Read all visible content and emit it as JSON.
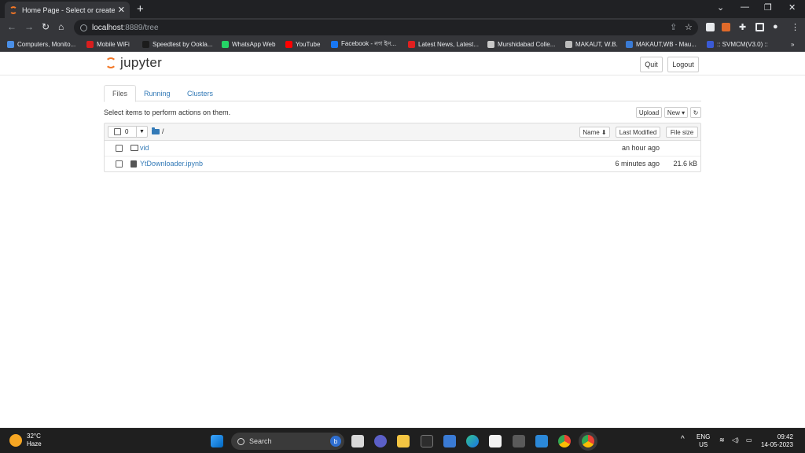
{
  "browser": {
    "tab_title": "Home Page - Select or create a n",
    "tab_close": "✕",
    "new_tab": "+",
    "url_host": "localhost",
    "url_path": ":8889/tree",
    "bookmarks": [
      {
        "label": "Computers, Monito...",
        "color": "#4a8fe7"
      },
      {
        "label": "Mobile WiFi",
        "color": "#d81e1e"
      },
      {
        "label": "Speedtest by Ookla...",
        "color": "#1c1c1c"
      },
      {
        "label": "WhatsApp Web",
        "color": "#25d366"
      },
      {
        "label": "YouTube",
        "color": "#ff0000"
      },
      {
        "label": "Facebook - নগ ইন...",
        "color": "#1877f2"
      },
      {
        "label": "Latest News, Latest...",
        "color": "#e02020"
      },
      {
        "label": "Murshidabad Colle...",
        "color": "#c9c9c9"
      },
      {
        "label": "MAKAUT, W.B.",
        "color": "#bbbbbb"
      },
      {
        "label": "MAKAUT,WB - Mau...",
        "color": "#3a7bd5"
      },
      {
        "label": ":: SVMCM(V3.0) ::",
        "color": "#3a5ad5"
      }
    ],
    "more_bookmarks": "»"
  },
  "jupyter": {
    "logo_text": "jupyter",
    "quit_label": "Quit",
    "logout_label": "Logout",
    "tabs": [
      "Files",
      "Running",
      "Clusters"
    ],
    "hint": "Select items to perform actions on them.",
    "upload_label": "Upload",
    "new_label": "New ▾",
    "refresh_label": "↻",
    "selected_count": "0",
    "breadcrumb": "/",
    "columns": {
      "name": "Name ⬇",
      "modified": "Last Modified",
      "size": "File size"
    },
    "rows": [
      {
        "name": "vid",
        "type": "folder",
        "modified": "an hour ago",
        "size": ""
      },
      {
        "name": "YtDownloader.ipynb",
        "type": "notebook",
        "modified": "6 minutes ago",
        "size": "21.6 kB"
      }
    ]
  },
  "taskbar": {
    "temperature": "32°C",
    "condition": "Haze",
    "search_placeholder": "Search",
    "lang_top": "ENG",
    "lang_bottom": "US",
    "time": "09:42",
    "date": "14-05-2023"
  }
}
